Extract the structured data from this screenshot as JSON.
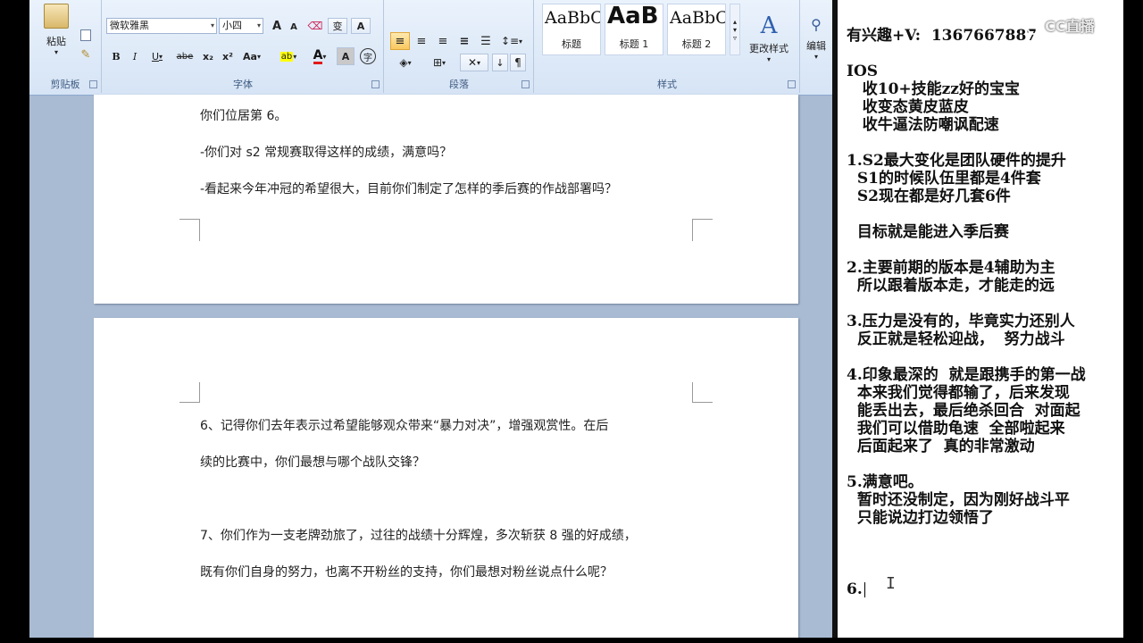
{
  "ribbon": {
    "clipboard": {
      "paste_label": "粘贴",
      "group_label": "剪贴板"
    },
    "font": {
      "font_name": "微软雅黑",
      "font_size": "小四",
      "grow_label": "A",
      "shrink_label": "A",
      "phonetic_label": "变",
      "charborder_label": "A",
      "bold": "B",
      "italic": "I",
      "underline": "U",
      "strike": "abe",
      "subscript": "x₂",
      "superscript": "x²",
      "case": "Aa",
      "highlight": "ab",
      "color_a": "A",
      "shade_a": "A",
      "enclose": "字",
      "group_label": "字体"
    },
    "paragraph": {
      "group_label": "段落"
    },
    "styles": {
      "items": [
        {
          "sample": "AaBbC",
          "name": "标题"
        },
        {
          "sample": "AaB",
          "name": "标题 1"
        },
        {
          "sample": "AaBbC",
          "name": "标题 2"
        }
      ],
      "change_styles_label": "更改样式",
      "group_label": "样式"
    },
    "editing": {
      "label": "编辑"
    }
  },
  "document": {
    "page1_lines": [
      "你们位居第 6。",
      "-你们对 s2 常规赛取得这样的成绩，满意吗？",
      "-看起来今年冲冠的希望很大，目前你们制定了怎样的季后赛的作战部署吗？"
    ],
    "page2_lines": [
      "6、记得你们去年表示过希望能够观众带来“暴力对决”，增强观赏性。在后",
      "续的比赛中，你们最想与哪个战队交锋？",
      "7、你们作为一支老牌劲旅了，过往的战绩十分辉煌，多次斩获  8  强的好成绩，",
      "既有你们自身的努力，也离不开粉丝的支持，你们最想对粉丝说点什么呢？"
    ]
  },
  "notes": {
    "lines": [
      "有兴趣+V:  1367667887",
      "",
      "IOS",
      "   收10+技能zz好的宝宝",
      "   收变态黄皮蓝皮",
      "   收牛逼法防嘲讽配速",
      "",
      "1.S2最大变化是团队硬件的提升",
      "  S1的时候队伍里都是4件套",
      "  S2现在都是好几套6件",
      "",
      "  目标就是能进入季后赛",
      "",
      "2.主要前期的版本是4辅助为主",
      "  所以跟着版本走，才能走的远",
      "",
      "3.压力是没有的，毕竟实力还别人",
      "  反正就是轻松迎战，  努力战斗",
      "",
      "4.印象最深的  就是跟携手的第一战",
      "  本来我们觉得都输了，后来发现",
      "  能丢出去，最后绝杀回合  对面起",
      "  我们可以借助龟速  全部啦起来",
      "  后面起来了  真的非常激动",
      "",
      "5.满意吧。",
      "  暂时还没制定，因为刚好战斗平",
      "  只能说边打边领悟了",
      "",
      "",
      "",
      "6."
    ]
  },
  "watermark": "CC直播"
}
